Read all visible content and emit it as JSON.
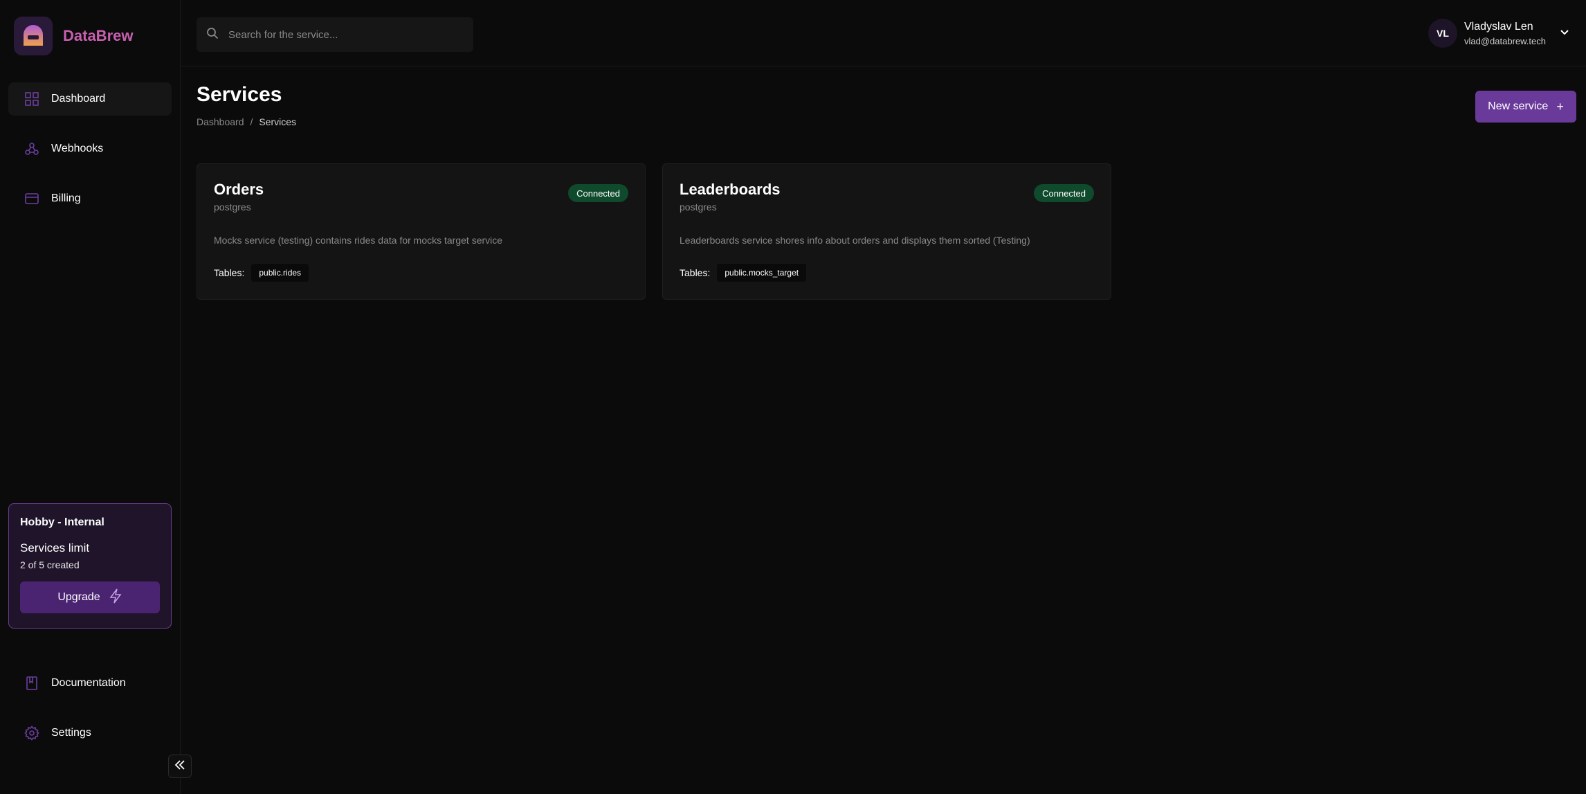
{
  "brand": {
    "name": "DataBrew"
  },
  "nav": {
    "items": [
      {
        "label": "Dashboard",
        "icon": "grid-icon"
      },
      {
        "label": "Webhooks",
        "icon": "webhook-icon"
      },
      {
        "label": "Billing",
        "icon": "credit-card-icon"
      }
    ],
    "bottom": [
      {
        "label": "Documentation",
        "icon": "book-icon"
      },
      {
        "label": "Settings",
        "icon": "gear-icon"
      }
    ]
  },
  "plan": {
    "name": "Hobby - Internal",
    "limit_label": "Services limit",
    "count_text": "2 of 5 created",
    "upgrade_label": "Upgrade"
  },
  "search": {
    "placeholder": "Search for the service..."
  },
  "user": {
    "initials": "VL",
    "name": "Vladyslav Len",
    "email": "vlad@databrew.tech"
  },
  "page": {
    "title": "Services",
    "breadcrumb": [
      "Dashboard",
      "Services"
    ],
    "new_button": "New service"
  },
  "services": [
    {
      "name": "Orders",
      "type": "postgres",
      "status": "Connected",
      "description": "Mocks service (testing) contains rides data for mocks target service",
      "tables_label": "Tables:",
      "tables": [
        "public.rides"
      ]
    },
    {
      "name": "Leaderboards",
      "type": "postgres",
      "status": "Connected",
      "description": "Leaderboards service shores info about orders and displays them sorted (Testing)",
      "tables_label": "Tables:",
      "tables": [
        "public.mocks_target"
      ]
    }
  ],
  "colors": {
    "accent": "#6a3a9a",
    "brand": "#c65fae",
    "icon": "#6b3fa0",
    "status_connected": "#0f4a2c"
  }
}
